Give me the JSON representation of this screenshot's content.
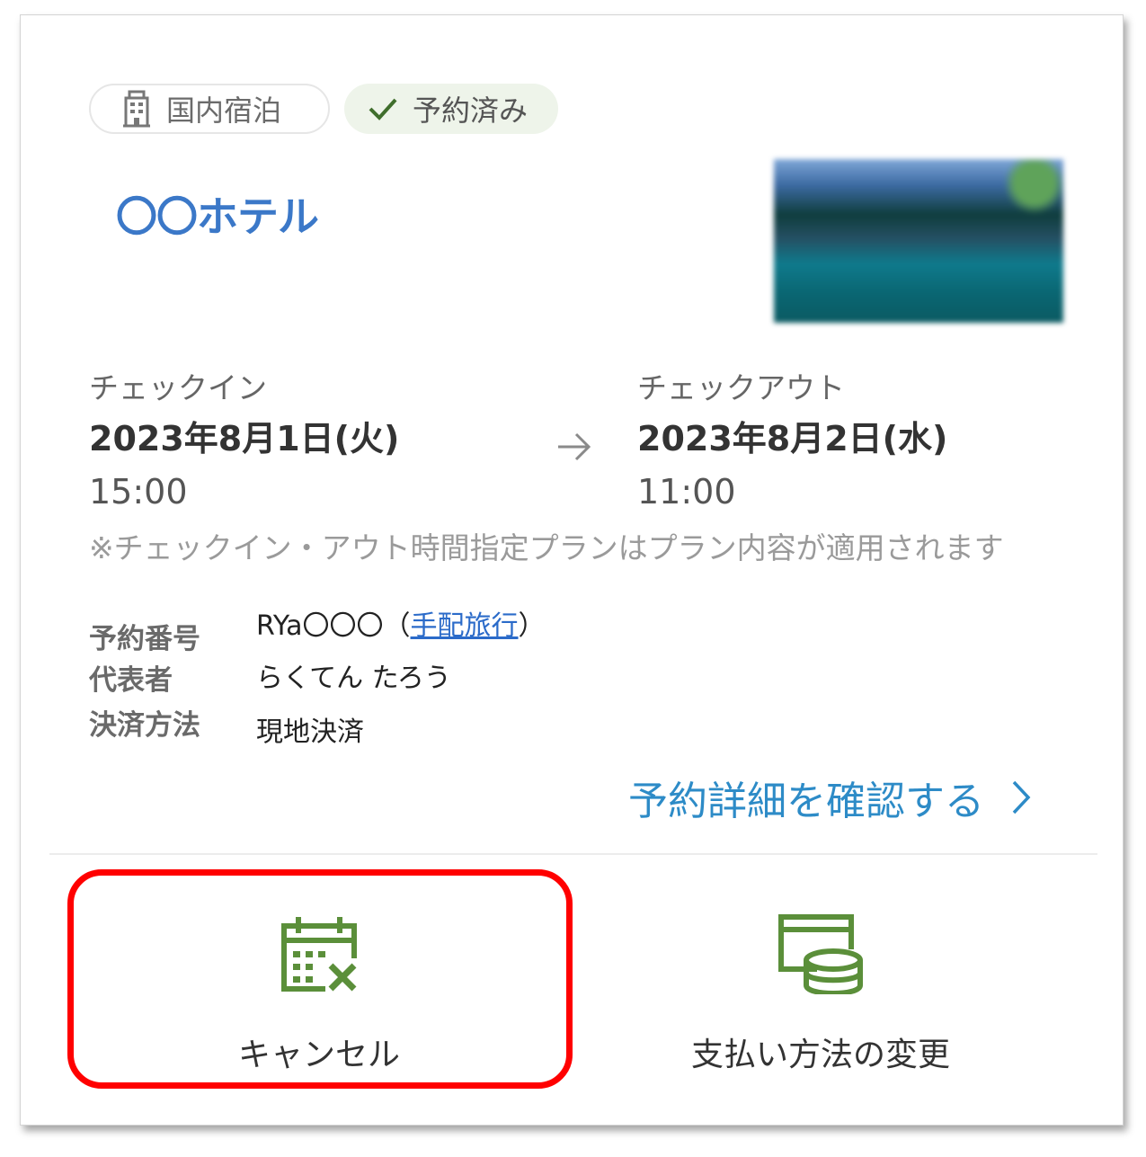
{
  "tags": {
    "type_label": "国内宿泊",
    "status_label": "予約済み"
  },
  "hotel": {
    "name": "〇〇ホテル"
  },
  "checkin": {
    "label": "チェックイン",
    "date": "2023年8月1日(火)",
    "time": "15:00"
  },
  "checkout": {
    "label": "チェックアウト",
    "date": "2023年8月2日(水)",
    "time": "11:00"
  },
  "note": "※チェックイン・アウト時間指定プランはプラン内容が適用されます",
  "info": {
    "reservation_no_label": "予約番号",
    "reservation_no_value": "RYa〇〇〇",
    "reservation_no_paren_open": "（",
    "reservation_no_link": "手配旅行",
    "reservation_no_paren_close": "）",
    "representative_label": "代表者",
    "representative_value": "らくてん たろう",
    "payment_label": "決済方法",
    "payment_value": "現地決済"
  },
  "detail_link": "予約詳細を確認する",
  "actions": {
    "cancel_label": "キャンセル",
    "change_payment_label": "支払い方法の変更"
  },
  "colors": {
    "accent_blue": "#3b78c8",
    "link_blue": "#2d8bc7",
    "icon_green": "#5b8f3a",
    "highlight_red": "#ff0000"
  }
}
